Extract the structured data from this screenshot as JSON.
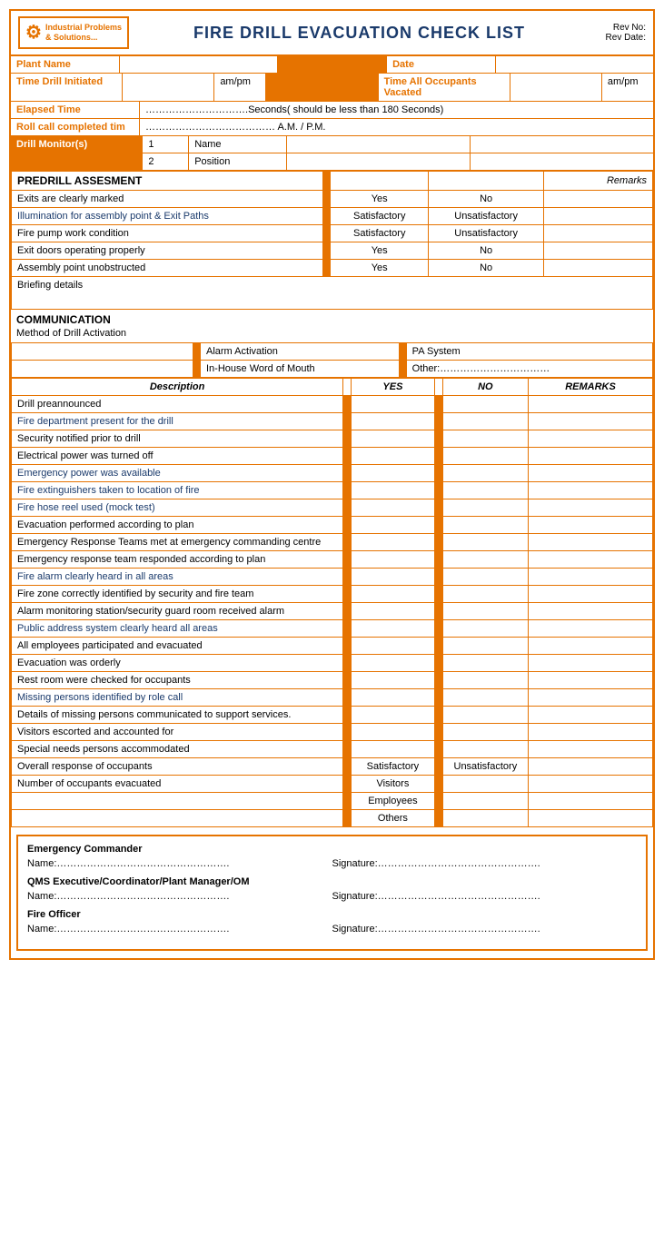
{
  "header": {
    "logo_line1": "Industrial Problems",
    "logo_line2": "& Solutions...",
    "title": "FIRE DRILL EVACUATION CHECK LIST",
    "rev_no": "Rev No:",
    "rev_date": "Rev Date:"
  },
  "info": {
    "plant_name_label": "Plant Name",
    "date_label": "Date",
    "time_drill_label": "Time Drill Initiated",
    "ampm1": "am/pm",
    "time_all_label": "Time All Occupants Vacated",
    "ampm2": "am/pm",
    "elapsed_label": "Elapsed Time",
    "elapsed_value": "………………………….Seconds( should be less than 180 Seconds)",
    "roll_call_label": "Roll call completed tim",
    "roll_call_value": "………………………………… A.M. / P.M.",
    "drill_monitors_label": "Drill Monitor(s)",
    "monitor1_num": "1",
    "monitor1_name": "Name",
    "monitor2_num": "2",
    "monitor2_pos": "Position"
  },
  "predrill": {
    "title": "PREDRILL ASSESMENT",
    "remarks_header": "Remarks",
    "rows": [
      {
        "label": "Exits are clearly marked",
        "col1": "Yes",
        "col2": "No",
        "blue": false
      },
      {
        "label": "Illumination for assembly point & Exit Paths",
        "col1": "Satisfactory",
        "col2": "Unsatisfactory",
        "blue": true
      },
      {
        "label": "Fire pump work condition",
        "col1": "Satisfactory",
        "col2": "Unsatisfactory",
        "blue": false
      },
      {
        "label": "Exit doors operating properly",
        "col1": "Yes",
        "col2": "No",
        "blue": false
      },
      {
        "label": "Assembly point unobstructed",
        "col1": "Yes",
        "col2": "No",
        "blue": false
      }
    ],
    "briefing_label": "Briefing details"
  },
  "communication": {
    "title": "COMMUNICATION",
    "subtitle": "Method of Drill Activation",
    "alarm": "Alarm Activation",
    "pa_system": "PA System",
    "inhouse": "In-House Word of Mouth",
    "other": "Other:……………………………",
    "table_headers": {
      "description": "Description",
      "yes": "YES",
      "no": "NO",
      "remarks": "REMARKS"
    },
    "rows": [
      {
        "label": "Drill preannounced",
        "blue": false
      },
      {
        "label": "Fire department present for the drill",
        "blue": true
      },
      {
        "label": "Security notified prior to drill",
        "blue": false
      },
      {
        "label": "Electrical power was turned off",
        "blue": false
      },
      {
        "label": "Emergency power was available",
        "blue": true
      },
      {
        "label": "Fire extinguishers taken to location of fire",
        "blue": true
      },
      {
        "label": "Fire hose reel used (mock test)",
        "blue": true
      },
      {
        "label": "Evacuation performed according to plan",
        "blue": false
      },
      {
        "label": "Emergency Response Teams met at emergency commanding centre",
        "blue": false
      },
      {
        "label": "Emergency response team responded according to plan",
        "blue": false
      },
      {
        "label": "Fire alarm clearly heard in all areas",
        "blue": true
      },
      {
        "label": "Fire zone correctly identified by security and fire team",
        "blue": false
      },
      {
        "label": "Alarm monitoring station/security guard room received alarm",
        "blue": false
      },
      {
        "label": "Public address system clearly heard all areas",
        "blue": true
      },
      {
        "label": "All employees participated and evacuated",
        "blue": false
      },
      {
        "label": "Evacuation was orderly",
        "blue": false
      },
      {
        "label": "Rest room were checked for occupants",
        "blue": false
      },
      {
        "label": "Missing persons identified by role call",
        "blue": true
      },
      {
        "label": "Details of missing persons communicated to support services.",
        "blue": false
      },
      {
        "label": "Visitors escorted and accounted for",
        "blue": false
      },
      {
        "label": "Special needs persons accommodated",
        "blue": false
      }
    ],
    "overall_label": "Overall response of occupants",
    "overall_sat": "Satisfactory",
    "overall_unsat": "Unsatisfactory",
    "num_evacuated_label": "Number of occupants evacuated",
    "visitors": "Visitors",
    "employees": "Employees",
    "others": "Others"
  },
  "signatures": {
    "emergency_commander": "Emergency Commander",
    "name1_label": "Name:…………………………………………….",
    "sig1_label": "Signature:………………………………………….",
    "qms_label": "QMS Executive/Coordinator/Plant Manager/OM",
    "name2_label": "Name:…………………………………………….",
    "sig2_label": "Signature:………………………………………….",
    "fire_officer": "Fire Officer",
    "name3_label": "Name:…………………………………………….",
    "sig3_label": "Signature:…………………………………………."
  }
}
